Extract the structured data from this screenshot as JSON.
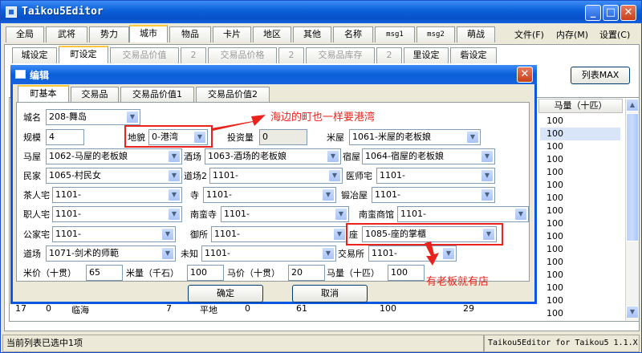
{
  "window": {
    "title": "Taikou5Editor",
    "minimize": "_",
    "maximize": "□",
    "close": "✕"
  },
  "main_tabs": [
    "全局",
    "武将",
    "势力",
    "城市",
    "物品",
    "卡片",
    "地区",
    "其他",
    "名称",
    "msg1",
    "msg2",
    "萌战"
  ],
  "main_tab_active": "城市",
  "menu": [
    "文件(F)",
    "内存(M)",
    "设置(C)"
  ],
  "sub_tabs": [
    "城设定",
    "町设定",
    "交易品价值",
    "2",
    "交易品价格",
    "2",
    "交易品库存",
    "2",
    "里设定",
    "砦设定"
  ],
  "sub_tab_active": "町设定",
  "list_button": "列表MAX",
  "table": {
    "column_header": "马量（十匹）",
    "values": [
      "100",
      "100",
      "100",
      "100",
      "100",
      "100",
      "100",
      "100",
      "100",
      "100",
      "100",
      "100",
      "100",
      "100",
      "100",
      "100"
    ]
  },
  "bg_row": {
    "c1": "17",
    "c2": "0",
    "c3": "临海",
    "c4": "7",
    "c5": "平地",
    "c6": "0",
    "c7": "61",
    "c8": "100",
    "c9": "29"
  },
  "dialog": {
    "title": "编辑",
    "close": "✕",
    "tabs": [
      "町基本",
      "交易品",
      "交易品价值1",
      "交易品价值2"
    ],
    "tab_active": "町基本",
    "fields": {
      "city_name": {
        "label": "城名",
        "value": "208-舞岛"
      },
      "scale": {
        "label": "规模",
        "value": "4"
      },
      "terrain": {
        "label": "地貌",
        "value": "0-港湾"
      },
      "investment": {
        "label": "投资量",
        "value": "0"
      },
      "rice_shop": {
        "label": "米屋",
        "value": "1061-米屋的老板娘"
      },
      "horse_shop": {
        "label": "马屋",
        "value": "1062-马屋的老板娘"
      },
      "tavern": {
        "label": "酒场",
        "value": "1063-酒场的老板娘"
      },
      "inn": {
        "label": "宿屋",
        "value": "1064-宿屋的老板娘"
      },
      "residence": {
        "label": "民家",
        "value": "1065-村民女"
      },
      "dojo2": {
        "label": "道场2",
        "value": "1101-"
      },
      "doctor": {
        "label": "医师宅",
        "value": "1101-"
      },
      "tea_master": {
        "label": "茶人宅",
        "value": "1101-"
      },
      "temple": {
        "label": "寺",
        "value": "1101-"
      },
      "smith": {
        "label": "锻冶屋",
        "value": "1101-"
      },
      "artisan": {
        "label": "职人宅",
        "value": "1101-"
      },
      "nanban_temple": {
        "label": "南蛮寺",
        "value": "1101-"
      },
      "nanban_shop": {
        "label": "南蛮商馆",
        "value": "1101-"
      },
      "noble": {
        "label": "公家宅",
        "value": "1101-"
      },
      "imperial": {
        "label": "御所",
        "value": "1101-"
      },
      "guild": {
        "label": "座",
        "value": "1085-座的掌櫃"
      },
      "dojo": {
        "label": "道场",
        "value": "1071-剑术的师範"
      },
      "unknown": {
        "label": "未知",
        "value": "1101-"
      },
      "exchange": {
        "label": "交易所",
        "value": "1101-"
      },
      "rice_price": {
        "label": "米价（十贯）",
        "value": "65"
      },
      "rice_amount": {
        "label": "米量（千石）",
        "value": "100"
      },
      "horse_price": {
        "label": "马价（十贯）",
        "value": "20"
      },
      "horse_amount": {
        "label": "马量（十匹）",
        "value": "100"
      }
    },
    "ok": "确定",
    "cancel": "取消"
  },
  "annotations": {
    "terrain_note": "海边的町也一样要港湾",
    "guild_note": "有老板就有店"
  },
  "status": {
    "left": "当前列表已选中1项",
    "right": "Taikou5Editor for Taikou5 1.1.X"
  },
  "colors": {
    "titlebar": "#0a5fd8",
    "annotation": "#e8241c",
    "xp_face": "#ece9d8"
  }
}
